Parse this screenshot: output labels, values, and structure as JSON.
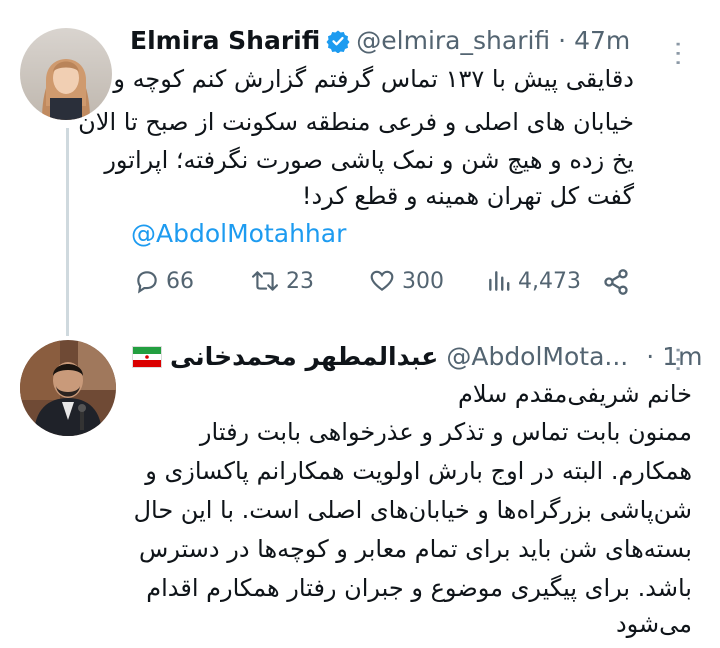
{
  "tweet1": {
    "name": "Elmira Sharifi",
    "handle": "@elmira_sharifi",
    "dot": "·",
    "time": "47m",
    "more": "···",
    "lines": [
      "دقایقی پیش با ۱۳۷ تماس گرفتم گزارش کنم کوچه و",
      "خیابان های اصلی و فرعی منطقه  سکونت از صبح تا الان",
      "یخ زده و هیچ شن و نمک پاشی صورت نگرفته؛ اپراتور",
      "گفت کل تهران همینه و قطع کرد!"
    ],
    "mention": "@AbdolMotahhar",
    "stats": {
      "replies": "66",
      "retweets": "23",
      "likes": "300",
      "views": "4,473"
    }
  },
  "tweet2": {
    "name": "عبدالمطهر محمدخانی",
    "handle": "@AbdolMota...",
    "dot": "·",
    "time": "1m",
    "more": "···",
    "lines": [
      "خانم شریفی‌مقدم سلام",
      "ممنون بابت تماس و تذکر و عذرخواهی بابت رفتار",
      "همکارم. البته در اوج بارش اولویت همکارانم پاکسازی و",
      "شن‌پاشی بزرگراه‌ها و خیابان‌های اصلی است. با این حال",
      "بسته‌های شن باید برای تمام معابر و کوچه‌ها در دسترس",
      "باشد. برای پیگیری موضوع و جبران رفتار همکارم اقدام",
      "می‌شود"
    ]
  },
  "colors": {
    "link": "#1d9bf0",
    "muted": "#536471",
    "thread_line": "#cfd9de"
  }
}
